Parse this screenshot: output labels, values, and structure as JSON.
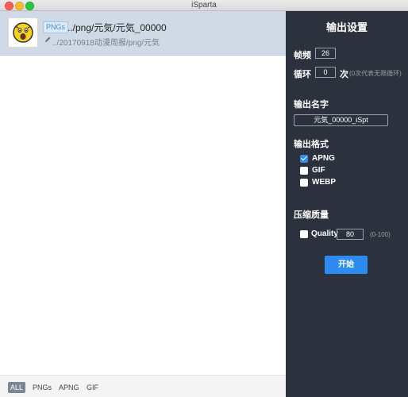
{
  "window": {
    "title": "iSparta"
  },
  "file_list": {
    "items": [
      {
        "badge": "PNGs",
        "path": "../png/元気/元気_00000",
        "dir": "../20170918动漫周报/png/元気"
      }
    ]
  },
  "filter_bar": {
    "buttons": [
      "ALL",
      "PNGs",
      "APNG",
      "GIF"
    ],
    "selected": "ALL"
  },
  "settings": {
    "heading": "输出设置",
    "fps_label": "帧频",
    "fps_value": "26",
    "loop_label": "循环",
    "loop_value": "0",
    "loop_unit": "次",
    "loop_hint": "(0次代表无限循环)",
    "name_label": "输出名字",
    "name_value": "元気_00000_iSpt",
    "format_label": "输出格式",
    "formats": [
      {
        "label": "APNG",
        "checked": true
      },
      {
        "label": "GIF",
        "checked": false
      },
      {
        "label": "WEBP",
        "checked": false
      }
    ],
    "quality_label": "压缩质量",
    "quality_option": "Quality",
    "quality_checked": false,
    "quality_value": "80",
    "quality_hint": "(0-100)",
    "start_label": "开始"
  },
  "colors": {
    "panel_bg": "#2c323d",
    "accent": "#2d8cf0",
    "selected_row": "#cfdae6"
  }
}
